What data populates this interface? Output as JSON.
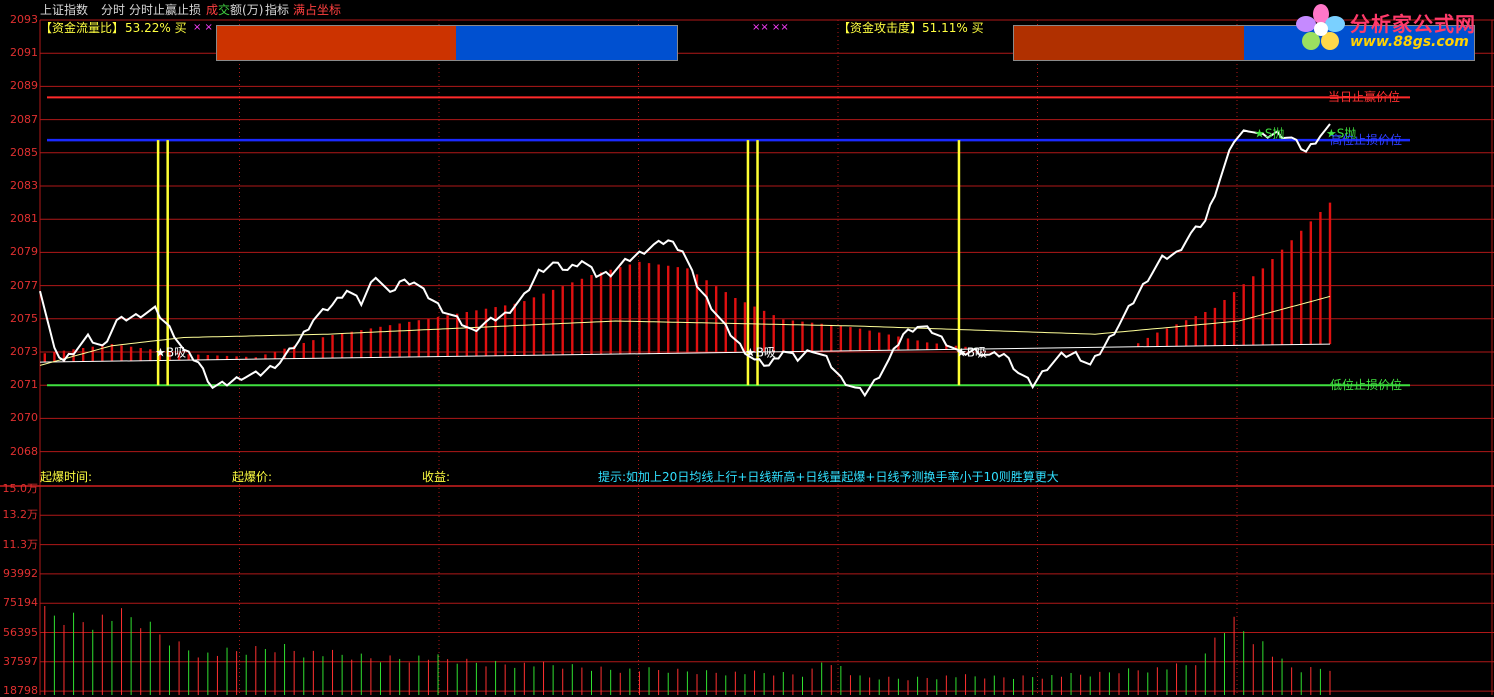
{
  "header": {
    "index_name": "上证指数",
    "menu": [
      "分时",
      "分时止赢止损"
    ],
    "turnover_prefix": "成",
    "turnover_mid": "交",
    "turnover_suffix": "额(万)",
    "indicator": "指标",
    "full_coord": "满占坐标"
  },
  "fund_flow": {
    "label": "【资金流量比】",
    "value": "53.22",
    "unit": "%",
    "action": "买",
    "marks": "× ×",
    "bar_split": 0.52,
    "color_left": "#cc3300",
    "color_right": "#0050d0"
  },
  "fund_attack": {
    "label": "【资金攻击度】",
    "value": "51.11",
    "unit": "%",
    "action": "买",
    "marks": "×× ××",
    "bar_split": 0.5,
    "color_left": "#b03000",
    "color_right": "#0050d0"
  },
  "logo": {
    "title": "分析家公式网",
    "url": "www.88gs.com"
  },
  "price_axis": [
    "2093",
    "2091",
    "2089",
    "2087",
    "2085",
    "2083",
    "2081",
    "2079",
    "2077",
    "2075",
    "2073",
    "2071",
    "2070",
    "2068"
  ],
  "volume_axis": [
    "15.0万",
    "13.2万",
    "11.3万",
    "93992",
    "75194",
    "56395",
    "37597",
    "18798"
  ],
  "levels": {
    "daily_stop_profit": {
      "label": "当日止赢价位",
      "price": 2088.6,
      "color": "#ff2a2a"
    },
    "high_stop_loss": {
      "label": "高位止损价位",
      "price": 2086.0,
      "color": "#1a2aff"
    },
    "low_stop_loss": {
      "label": "低位止损价位",
      "price": 2071.1,
      "color": "#40e040"
    }
  },
  "signals": {
    "buy": "B吸",
    "sell": "S抛"
  },
  "bottom_labels": {
    "start_time": "起爆时间:",
    "start_price": "起爆价:",
    "profit": "收益:",
    "tip": "提示:如加上20日均线上行+日线新高+日线量起爆+日线予测换手率小于10则胜算更大"
  },
  "colors": {
    "price_line": "#ffffff",
    "avg_line": "#ffff99",
    "bars_up": "#e01010",
    "bars_low": "#30e030",
    "vertical_signal": "#ffff33",
    "grid": "#b01818"
  },
  "chart_data": {
    "type": "line",
    "x_count": 250,
    "ylim": [
      2067.0,
      2093.3
    ],
    "price_anchors": [
      [
        0,
        2077.0
      ],
      [
        3,
        2073.2
      ],
      [
        5,
        2072.6
      ],
      [
        10,
        2074.0
      ],
      [
        13,
        2073.4
      ],
      [
        16,
        2075.0
      ],
      [
        20,
        2075.3
      ],
      [
        24,
        2075.7
      ],
      [
        28,
        2074.2
      ],
      [
        30,
        2073.2
      ],
      [
        33,
        2072.5
      ],
      [
        36,
        2071.0
      ],
      [
        39,
        2071.2
      ],
      [
        42,
        2071.6
      ],
      [
        46,
        2071.8
      ],
      [
        50,
        2072.5
      ],
      [
        54,
        2073.8
      ],
      [
        57,
        2075.1
      ],
      [
        61,
        2076.0
      ],
      [
        64,
        2076.9
      ],
      [
        67,
        2076.1
      ],
      [
        70,
        2077.8
      ],
      [
        73,
        2076.6
      ],
      [
        75,
        2077.4
      ],
      [
        78,
        2077.4
      ],
      [
        81,
        2076.5
      ],
      [
        84,
        2075.7
      ],
      [
        87,
        2075.1
      ],
      [
        90,
        2074.4
      ],
      [
        93,
        2074.9
      ],
      [
        97,
        2075.4
      ],
      [
        101,
        2076.5
      ],
      [
        104,
        2078.0
      ],
      [
        107,
        2078.5
      ],
      [
        110,
        2078.1
      ],
      [
        113,
        2078.7
      ],
      [
        116,
        2077.8
      ],
      [
        119,
        2077.9
      ],
      [
        122,
        2078.6
      ],
      [
        125,
        2079.1
      ],
      [
        128,
        2079.6
      ],
      [
        131,
        2079.9
      ],
      [
        134,
        2079.3
      ],
      [
        137,
        2077.2
      ],
      [
        140,
        2075.9
      ],
      [
        143,
        2074.6
      ],
      [
        146,
        2073.5
      ],
      [
        149,
        2072.6
      ],
      [
        152,
        2072.3
      ],
      [
        155,
        2073.2
      ],
      [
        158,
        2072.7
      ],
      [
        161,
        2073.3
      ],
      [
        164,
        2072.7
      ],
      [
        167,
        2071.5
      ],
      [
        170,
        2070.9
      ],
      [
        172,
        2070.6
      ],
      [
        174,
        2071.3
      ],
      [
        177,
        2072.6
      ],
      [
        180,
        2074.2
      ],
      [
        183,
        2074.7
      ],
      [
        186,
        2074.4
      ],
      [
        189,
        2073.7
      ],
      [
        192,
        2073.0
      ],
      [
        195,
        2073.2
      ],
      [
        198,
        2072.9
      ],
      [
        201,
        2073.0
      ],
      [
        204,
        2071.9
      ],
      [
        207,
        2071.1
      ],
      [
        210,
        2072.2
      ],
      [
        213,
        2072.9
      ],
      [
        216,
        2073.0
      ],
      [
        219,
        2072.3
      ],
      [
        222,
        2073.5
      ],
      [
        225,
        2074.8
      ],
      [
        228,
        2076.2
      ],
      [
        231,
        2077.6
      ],
      [
        234,
        2078.8
      ],
      [
        237,
        2079.1
      ],
      [
        240,
        2080.3
      ],
      [
        243,
        2081.1
      ],
      [
        246,
        2083.6
      ],
      [
        249,
        2086.0
      ],
      [
        252,
        2086.7
      ],
      [
        255,
        2086.2
      ],
      [
        258,
        2086.4
      ],
      [
        261,
        2086.1
      ],
      [
        264,
        2085.3
      ],
      [
        267,
        2086.3
      ],
      [
        269,
        2086.8
      ]
    ],
    "avg_anchors": [
      [
        0,
        2072.3
      ],
      [
        15,
        2073.5
      ],
      [
        30,
        2074.0
      ],
      [
        60,
        2074.2
      ],
      [
        120,
        2075.0
      ],
      [
        170,
        2074.7
      ],
      [
        220,
        2074.2
      ],
      [
        250,
        2075.0
      ],
      [
        269,
        2076.5
      ]
    ],
    "lower_band": [
      [
        0,
        2072.5
      ],
      [
        269,
        2073.6
      ]
    ],
    "upper_band": [
      [
        0,
        2073.0
      ],
      [
        15,
        2073.6
      ],
      [
        30,
        2073.0
      ],
      [
        45,
        2072.8
      ],
      [
        60,
        2074.1
      ],
      [
        80,
        2075.1
      ],
      [
        100,
        2076.1
      ],
      [
        115,
        2077.8
      ],
      [
        125,
        2078.6
      ],
      [
        135,
        2078.2
      ],
      [
        145,
        2076.4
      ],
      [
        155,
        2075.1
      ],
      [
        170,
        2074.6
      ],
      [
        185,
        2073.7
      ],
      [
        200,
        2073.2
      ],
      [
        210,
        2073.0
      ],
      [
        225,
        2073.0
      ],
      [
        233,
        2074.3
      ],
      [
        245,
        2075.8
      ],
      [
        255,
        2078.2
      ],
      [
        269,
        2082.2
      ]
    ],
    "signal_columns": [
      24,
      26,
      147,
      149,
      191
    ],
    "buy_points": [
      [
        24,
        2073.1
      ],
      [
        147,
        2073.1
      ],
      [
        191,
        2073.1
      ]
    ],
    "sell_points": [
      [
        254,
        2086.4
      ],
      [
        269,
        2086.4
      ]
    ],
    "volume_ylim": [
      0,
      150000
    ],
    "volume_anchors": [
      [
        0,
        140000
      ],
      [
        1,
        60000
      ],
      [
        5,
        58000
      ],
      [
        10,
        55000
      ],
      [
        15,
        58000
      ],
      [
        20,
        56000
      ],
      [
        25,
        45000
      ],
      [
        30,
        35000
      ],
      [
        35,
        30000
      ],
      [
        45,
        33000
      ],
      [
        50,
        36000
      ],
      [
        55,
        32000
      ],
      [
        60,
        30000
      ],
      [
        70,
        27000
      ],
      [
        80,
        28000
      ],
      [
        90,
        24000
      ],
      [
        100,
        23000
      ],
      [
        110,
        21000
      ],
      [
        120,
        19000
      ],
      [
        130,
        18000
      ],
      [
        140,
        17000
      ],
      [
        150,
        16000
      ],
      [
        160,
        15000
      ],
      [
        164,
        28000
      ],
      [
        170,
        13000
      ],
      [
        180,
        12000
      ],
      [
        190,
        14000
      ],
      [
        200,
        13000
      ],
      [
        210,
        14000
      ],
      [
        220,
        15000
      ],
      [
        225,
        18000
      ],
      [
        235,
        20000
      ],
      [
        240,
        22000
      ],
      [
        243,
        28000
      ],
      [
        246,
        50000
      ],
      [
        249,
        54000
      ],
      [
        252,
        46000
      ],
      [
        255,
        38000
      ],
      [
        258,
        26000
      ],
      [
        262,
        18000
      ],
      [
        269,
        20000
      ]
    ]
  }
}
